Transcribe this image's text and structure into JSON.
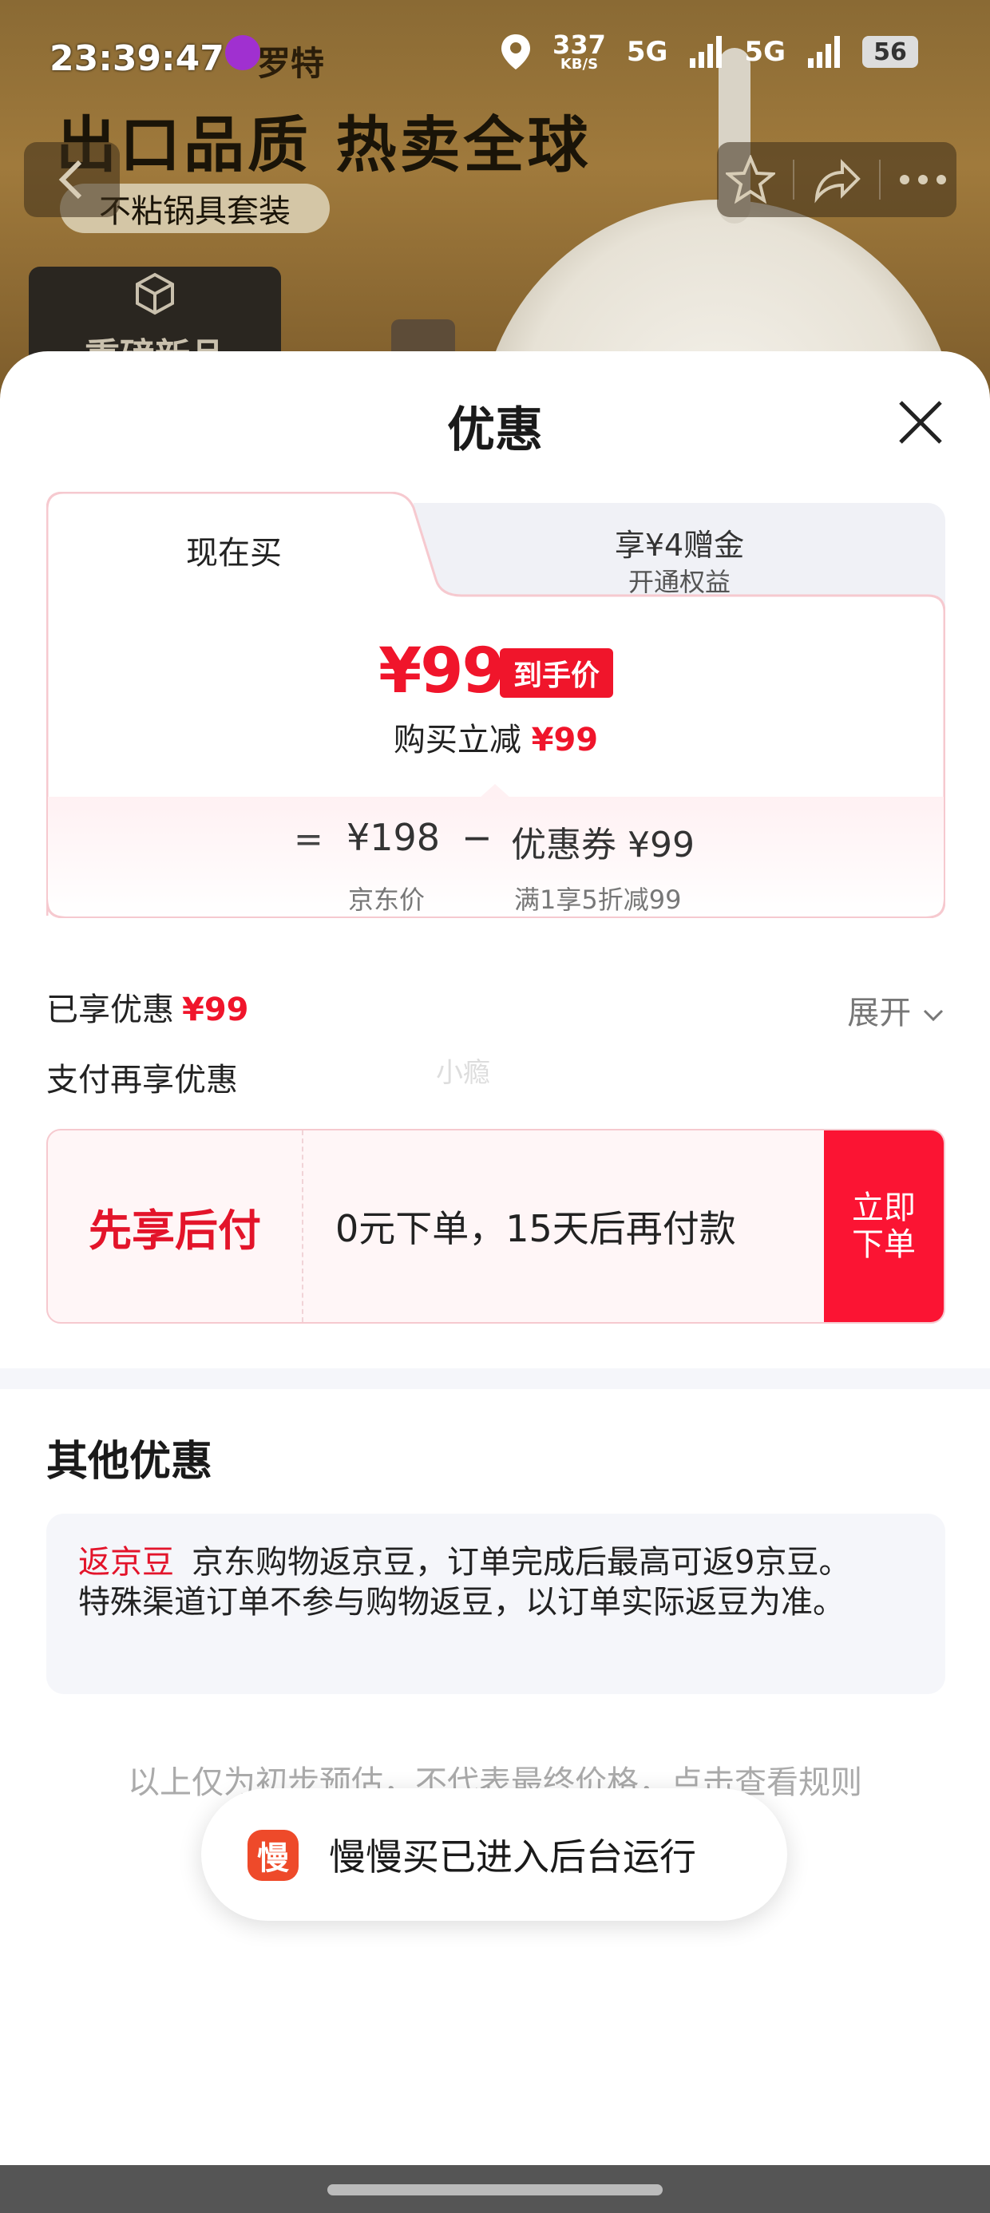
{
  "background": {
    "headline": "出口品质 热卖全球",
    "tag_pill": "不粘锅具套装",
    "new_badge": "重磅新品"
  },
  "status_bar": {
    "time": "23:39:47",
    "app_name": "罗特",
    "net_speed": "337",
    "net_unit": "KB/S",
    "signal1": "5G",
    "signal2": "5G",
    "battery": "56"
  },
  "sheet": {
    "title": "优惠",
    "tabs": [
      {
        "label": "现在买"
      },
      {
        "label": "享¥4赠金",
        "sublabel": "开通权益"
      }
    ],
    "final_price": "¥99",
    "final_price_badge": "到手价",
    "reduce_label": "购买立减",
    "reduce_amount": "¥99",
    "equals_sign": "=",
    "jd_price": "¥198",
    "jd_price_label": "京东价",
    "minus_sign": "−",
    "coupon_text": "优惠券 ¥99",
    "coupon_label": "满1享5折减99",
    "enjoyed_label": "已享优惠",
    "enjoyed_amount": "¥99",
    "expand_label": "展开",
    "pay_again_label": "支付再享优惠",
    "watermark": "小瘾",
    "pay_later": {
      "name": "先享后付",
      "description": "0元下单，15天后再付款",
      "button_line1": "立即",
      "button_line2": "下单"
    },
    "other_title": "其他优惠",
    "bean": {
      "tag": "返京豆",
      "text": "京东购物返京豆，订单完成后最高可返9京豆。特殊渠道订单不参与购物返豆，以订单实际返豆为准。"
    },
    "disclaimer": "以上仅为初步预估，不代表最终价格，点击查看规则"
  },
  "toast": {
    "logo_char": "慢",
    "message": "慢慢买已进入后台运行"
  },
  "colors": {
    "accent_red": "#f0152b",
    "button_red": "#fb1433",
    "toast_logo": "#ee4a2a"
  }
}
